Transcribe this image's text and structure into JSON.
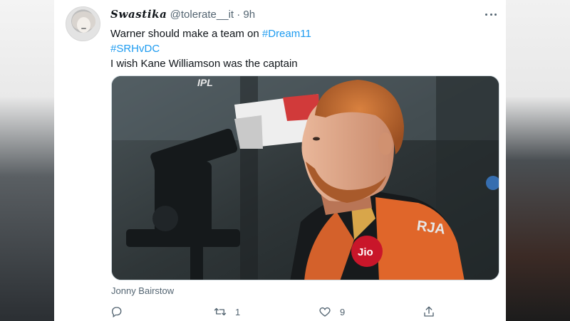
{
  "tweet": {
    "display_name": "Swastika",
    "handle": "@tolerate__it",
    "separator": "·",
    "time": "9h",
    "line1_text": "Warner should make a team on ",
    "line1_hashtag": "#Dream11",
    "line2_hashtag": "#SRHvDC",
    "line3_text": "I wish Kane Williamson was the captain",
    "media_caption": "Jonny Bairstow",
    "media_overlay": {
      "ipl_logo_text": "IPL",
      "jersey_sponsor": "Jio",
      "jersey_text": "RJA"
    }
  },
  "actions": {
    "reply_icon": "reply-icon",
    "retweet_icon": "retweet-icon",
    "retweet_count": "1",
    "like_icon": "heart-icon",
    "like_count": "9",
    "share_icon": "share-icon"
  },
  "colors": {
    "link": "#1d9bf0",
    "text": "#0f1419",
    "muted": "#536471"
  }
}
